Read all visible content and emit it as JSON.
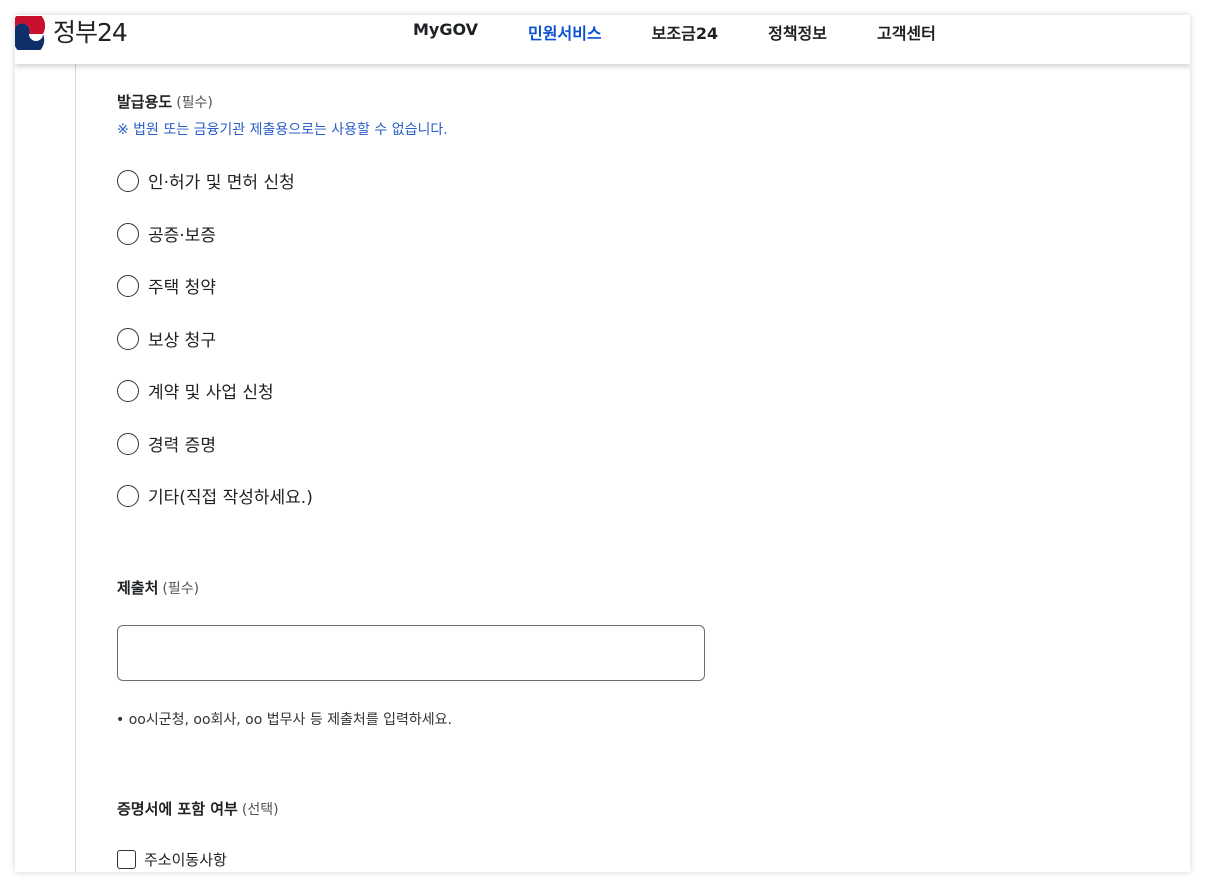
{
  "header": {
    "logo_text": "정부24",
    "nav": [
      "MyGOV",
      "민원서비스",
      "보조금24",
      "정책정보",
      "고객센터"
    ],
    "active_nav": "민원서비스"
  },
  "purpose": {
    "title": "발급용도",
    "required": "(필수)",
    "notice": "※ 법원 또는 금융기관 제출용으로는 사용할 수 없습니다.",
    "options": [
      "인·허가 및 면허 신청",
      "공증·보증",
      "주택 청약",
      "보상 청구",
      "계약 및 사업 신청",
      "경력 증명",
      "기타(직접 작성하세요.)"
    ]
  },
  "submit_to": {
    "title": "제출처",
    "required": "(필수)",
    "value": "",
    "hint": "• oo시군청, oo회사, oo 법무사 등 제출처를 입력하세요."
  },
  "include": {
    "title": "증명서에 포함 여부",
    "optional": "(선택)",
    "checkbox_label": "주소이동사항",
    "checked": false
  },
  "colors": {
    "accent": "#0b50d0",
    "notice": "#2a5ec8"
  }
}
